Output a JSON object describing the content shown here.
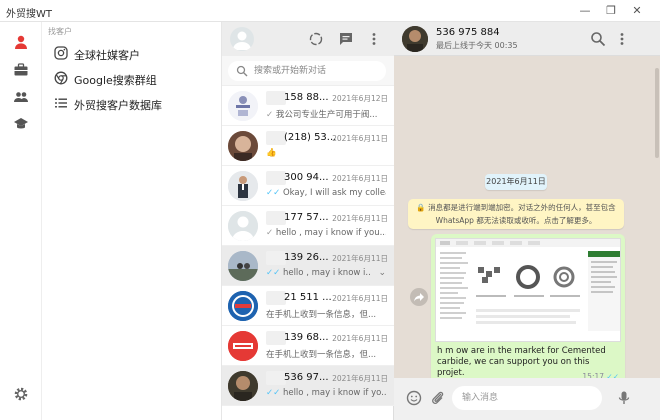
{
  "window": {
    "title": "外贸搜WT",
    "minimize": "—",
    "restore": "❐",
    "close": "✕"
  },
  "nav": {
    "section_label": "找客户",
    "items": [
      {
        "label": "全球社媒客户"
      },
      {
        "label": "Google搜索群组"
      },
      {
        "label": "外贸搜客户数据库"
      }
    ]
  },
  "search": {
    "placeholder": "搜索或开始新对话"
  },
  "chats": [
    {
      "name": "158 88...",
      "date": "2021年6月12日",
      "tick": "✓",
      "preview": "我公司专业生产可用于阀..."
    },
    {
      "name": "(218) 53...",
      "date": "2021年6月11日",
      "tick": "",
      "preview": "👍"
    },
    {
      "name": "300 94...",
      "date": "2021年6月11日",
      "tick": "✓✓",
      "preview": "Okay, I will ask my colleag..."
    },
    {
      "name": "177 57...",
      "date": "2021年6月11日",
      "tick": "✓",
      "preview": "hello , may i know if you..."
    },
    {
      "name": "139 26...",
      "date": "2021年6月11日",
      "tick": "✓✓",
      "preview": "hello , may i know i...",
      "chevron": "⌄"
    },
    {
      "name": "21 511 ...",
      "date": "2021年6月11日",
      "tick": "",
      "preview": "在手机上收到一条信息，但..."
    },
    {
      "name": "139 68...",
      "date": "2021年6月11日",
      "tick": "",
      "preview": "在手机上收到一条信息，但..."
    },
    {
      "name": "536 97...",
      "date": "2021年6月11日",
      "tick": "✓✓",
      "preview": "hello , may i know if yo..."
    }
  ],
  "conversation": {
    "name": "536 975 884",
    "status": "最后上线于今天 00:35",
    "date_pill": "2021年6月11日",
    "system_message": "🔒 消息都是进行端到端加密。对话之外的任何人，甚至包含 WhatsApp 都无法读取或收听。点击了解更多。",
    "message_text": "h          m          ow          are in the market for Cemented carbide, we can support you on this projet.",
    "message_time": "15:17",
    "message_tick": "✓✓",
    "input_placeholder": "输入消息"
  },
  "colors": {
    "accent_red": "#e53935",
    "read_tick": "#4fc3f7",
    "chat_bg": "#e5ddd5",
    "bubble_out": "#dcf8c6",
    "system_bg": "#fff5c4",
    "date_pill_bg": "#e1f3fb"
  },
  "icons": {
    "rail": [
      "user-icon",
      "briefcase-icon",
      "group-icon",
      "graduation-icon",
      "gear-icon"
    ],
    "nav": [
      "instagram-icon",
      "chrome-icon",
      "list-icon"
    ],
    "header": [
      "status-icon",
      "chat-icon",
      "menu-icon",
      "search-icon"
    ],
    "composer": [
      "emoji-icon",
      "attach-icon",
      "mic-icon"
    ]
  }
}
